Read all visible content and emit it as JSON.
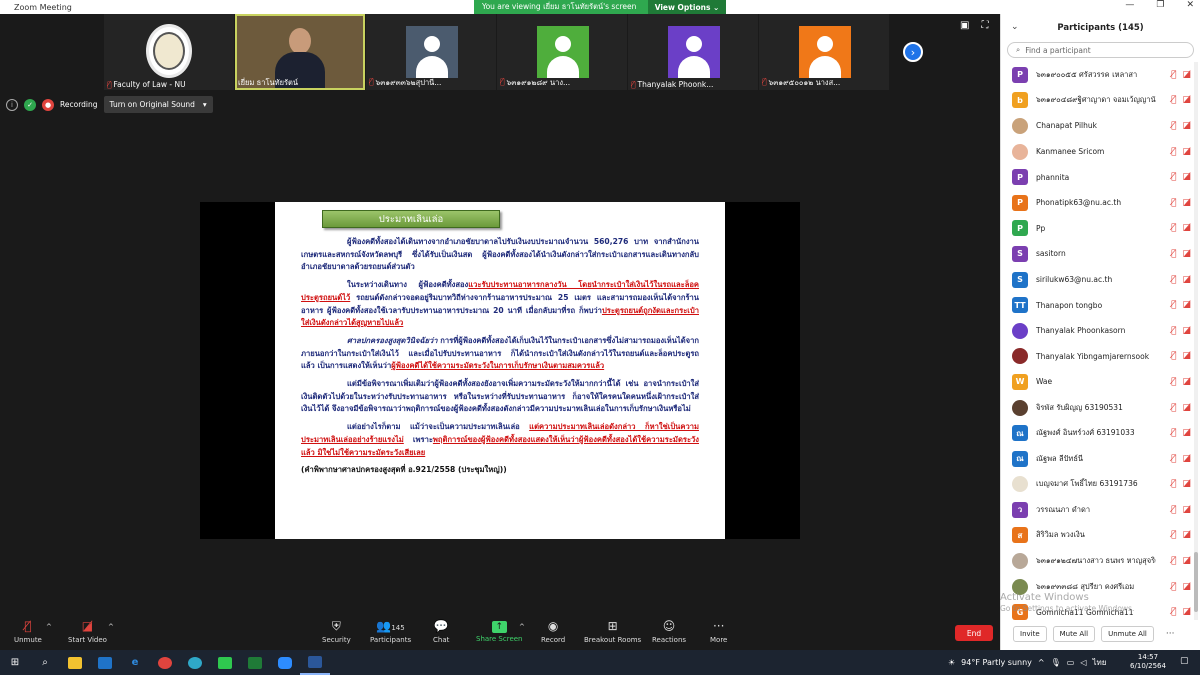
{
  "window": {
    "title": "Zoom Meeting"
  },
  "banner": {
    "text": "You are viewing เยี่ยม ธาโนทัยรัตน์'s screen",
    "options_label": "View Options ⌄"
  },
  "thumbnails": [
    {
      "name": "Faculty of Law - NU",
      "kind": "seal",
      "muted": true
    },
    {
      "name": "เยี่ยม ธาโนทัยรัตน์",
      "kind": "person",
      "muted": false,
      "active": true
    },
    {
      "name": "๖๓๑๙๓๓๖๒สุปานี...",
      "kind": "avatar",
      "color": "#4b5b6e",
      "muted": true
    },
    {
      "name": "๖๓๑๙๑๒๘๙ นาง...",
      "kind": "avatar",
      "color": "#4fae3c",
      "muted": true
    },
    {
      "name": "Thanyalak Phoonk...",
      "kind": "avatar",
      "color": "#6b3fc7",
      "muted": true
    },
    {
      "name": "๖๓๑๙๕๐๐๑๒ นางส...",
      "kind": "avatar",
      "color": "#f07818",
      "muted": true
    }
  ],
  "status": {
    "recording": "Recording",
    "sound_button": "Turn on Original Sound"
  },
  "slide": {
    "title": "ประมาทเลินเล่อ",
    "paragraphs": [
      [
        {
          "t": "ผู้ฟ้องคดีทั้งสองได้เดินทางจากอำเภอชัยบาดาลไปรับเงินงบประมาณจำนวน 560,276 บาท จากสำนักงานเกษตรและสหกรณ์จังหวัดลพบุรี ซึ่งได้รับเป็นเงินสด ผู้ฟ้องคดีทั้งสองได้นำเงินดังกล่าวใส่กระเป๋าเอกสารและเดินทางกลับอำเภอชัยบาดาลด้วยรถยนต์ส่วนตัว"
        }
      ],
      [
        {
          "t": "ในระหว่างเดินทาง ผู้ฟ้องคดีทั้งสอง"
        },
        {
          "t": "แวะรับประทานอาหารกลางวัน โดยนำกระเป๋าใส่เงินไว้ในรถและล็อคประตูรถยนต์ไว้",
          "red": true
        },
        {
          "t": " รถยนต์ดังกล่าวจอดอยู่ริมบาทวิถีห่างจากร้านอาหารประมาณ 25 เมตร และสามารถมองเห็นได้จากร้านอาหาร ผู้ฟ้องคดีทั้งสองใช้เวลารับประทานอาหารประมาณ 20 นาที เมื่อกลับมาที่รถ ก็พบว่า"
        },
        {
          "t": "ประตูรถยนต์ถูกงัดและกระเป๋าใส่เงินดังกล่าวได้สูญหายไปแล้ว",
          "red": true
        }
      ],
      [
        {
          "t": "ศาลปกครองสูงสุดวินิจฉัยว่า",
          "ital": true
        },
        {
          "t": " การที่ผู้ฟ้องคดีทั้งสองได้เก็บเงินไว้ในกระเป๋าเอกสารซึ่งไม่สามารถมองเห็นได้จากภายนอกว่าในกระเป๋าใส่เงินไว้ และเมื่อไปรับประทานอาหาร ก็ได้นำกระเป๋าใส่เงินดังกล่าวไว้ในรถยนต์และล็อคประตูรถแล้ว เป็นการแสดงให้เห็นว่า"
        },
        {
          "t": "ผู้ฟ้องคดีได้ใช้ความระมัดระวังในการเก็บรักษาเงินตามสมควรแล้ว",
          "red": true
        }
      ],
      [
        {
          "t": "แต่มีข้อพิจารณาเพิ่มเติมว่าผู้ฟ้องคดีทั้งสองยังอาจเพิ่มความระมัดระวังให้มากกว่านี้ได้ เช่น อาจนำกระเป๋าใส่เงินติดตัวไปด้วยในระหว่างรับประทานอาหาร หรือในระหว่างที่รับประทานอาหาร ก็อาจให้ใครคนใดคนหนึ่งเฝ้ากระเป๋าใส่เงินไว้ได้ จึงอาจมีข้อพิจารณาว่าพฤติการณ์ของผู้ฟ้องคดีทั้งสองดังกล่าวมีความประมาทเลินเล่อในการเก็บรักษาเงินหรือไม่"
        }
      ],
      [
        {
          "t": "แต่อย่างไรก็ตาม แม้ว่าจะเป็นความประมาทเลินเล่อ "
        },
        {
          "t": "แต่ความประมาทเลินเล่อดังกล่าว ก็หาใช่เป็นความประมาทเลินเล่ออย่างร้ายแรงไม่",
          "red": true
        },
        {
          "t": " เพราะ"
        },
        {
          "t": "พฤติการณ์ของผู้ฟ้องคดีทั้งสองแสดงให้เห็นว่าผู้ฟ้องคดีทั้งสองได้ใช้ความระมัดระวังแล้ว มิใช่ไม่ใช้ความระมัดระวังเสียเลย",
          "red": true
        }
      ]
    ],
    "citation": "(คำพิพากษาศาลปกครองสูงสุดที่ อ.921/2558 (ประชุมใหญ่))"
  },
  "toolbar": {
    "unmute": "Unmute",
    "start_video": "Start Video",
    "security": "Security",
    "participants": "Participants",
    "participants_count": "145",
    "chat": "Chat",
    "share_screen": "Share Screen",
    "record": "Record",
    "breakout": "Breakout Rooms",
    "reactions": "Reactions",
    "more": "More",
    "end": "End"
  },
  "panel": {
    "title": "Participants (145)",
    "search_placeholder": "Find a participant",
    "participants": [
      {
        "initial": "P",
        "color": "#7b3fb0",
        "name": "๖๓๑๙๐๐๕๕ ศรัสวรรค เหลาสา"
      },
      {
        "initial": "b",
        "color": "#f0a020",
        "name": "๖๓๑๙๐๔๘๙ฐิศาญาดา จอมเว้ญญานัน"
      },
      {
        "initial": "",
        "color": "#c9a27a",
        "name": "Chanapat Pilhuk",
        "photo": true
      },
      {
        "initial": "",
        "color": "#e8b49a",
        "name": "Kanmanee Sricom",
        "photo": true
      },
      {
        "initial": "P",
        "color": "#7b3fb0",
        "name": "phannita"
      },
      {
        "initial": "P",
        "color": "#e8731a",
        "name": "Phonatipk63@nu.ac.th"
      },
      {
        "initial": "P",
        "color": "#2fa84f",
        "name": "Pp"
      },
      {
        "initial": "S",
        "color": "#7b3fb0",
        "name": "sasitorn"
      },
      {
        "initial": "S",
        "color": "#1f73c8",
        "name": "sirilukw63@nu.ac.th"
      },
      {
        "initial": "TT",
        "color": "#1f73c8",
        "name": "Thanapon tongbo"
      },
      {
        "initial": "",
        "color": "#6b3fc7",
        "name": "Thanyalak Phoonkasorn",
        "photo": true
      },
      {
        "initial": "",
        "color": "#8a2a2a",
        "name": "Thanyalak Yibngamjarernsook",
        "photo": true
      },
      {
        "initial": "W",
        "color": "#f0a020",
        "name": "Wae"
      },
      {
        "initial": "",
        "color": "#5a4030",
        "name": "จิรพัส รับผิญญ 63190531",
        "photo": true
      },
      {
        "initial": "ณ",
        "color": "#1f73c8",
        "name": "ณัฐพงศ์ อินทร์วงศ์ 63191033"
      },
      {
        "initial": "ณ",
        "color": "#1f73c8",
        "name": "ณัฐพล ลีปัทธ์นี"
      },
      {
        "initial": "",
        "color": "#e8e0d0",
        "name": "เบญจมาศ โพธิ์ไทย 63191736",
        "photo": true
      },
      {
        "initial": "ว",
        "color": "#7b3fb0",
        "name": "วรรณนภา ดำดา"
      },
      {
        "initial": "ส",
        "color": "#e8731a",
        "name": "สิริวิมล พวงเงิน"
      },
      {
        "initial": "",
        "color": "#b8a898",
        "name": "๖๓๑๙๑๒๔๗นางสาว ธนพร หาญสุจริต...",
        "photo": true
      },
      {
        "initial": "",
        "color": "#7a8a50",
        "name": "๖๓๑๙๓๓๘๘ สุปรียา คงศรีเอม",
        "photo": true
      },
      {
        "initial": "G",
        "color": "#e8731a",
        "name": "Gomnicha11 Gomnicha11"
      }
    ],
    "invite": "Invite",
    "mute_all": "Mute All",
    "unmute_all": "Unmute All"
  },
  "watermark": {
    "line1": "Activate Windows",
    "line2": "Go to Settings to activate Windows."
  },
  "taskbar": {
    "weather": "94°F  Partly sunny",
    "lang": "ไทย",
    "time": "14:57",
    "date": "6/10/2564"
  }
}
